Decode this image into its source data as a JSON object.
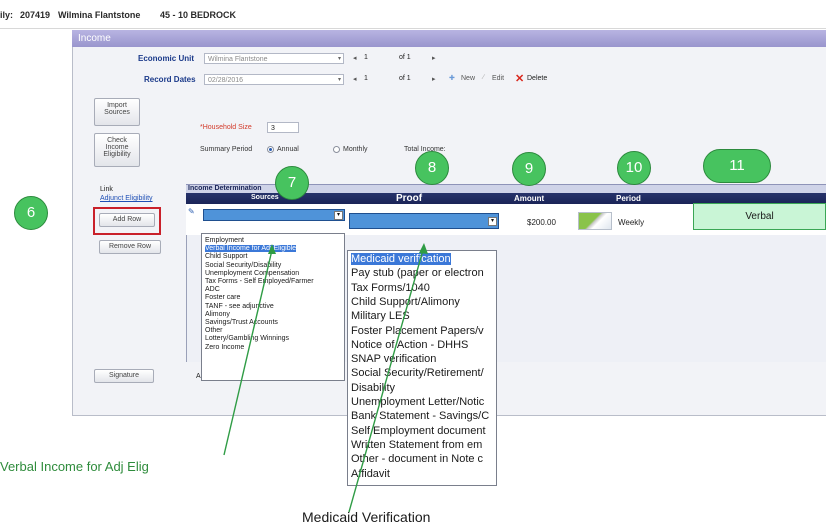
{
  "header": {
    "family_label": "ily:",
    "family_id": "207419",
    "family_name": "Wilmina Flantstone",
    "address": "45 - 10 BEDROCK"
  },
  "panel": {
    "title": "Income"
  },
  "economic_unit": {
    "label": "Economic Unit",
    "value": "Wilmina Flantstone",
    "page": "1",
    "of": "of 1"
  },
  "record_dates": {
    "label": "Record Dates",
    "value": "02/28/2016",
    "page": "1",
    "of": "of 1",
    "new_label": "New",
    "edit_label": "Edit",
    "delete_label": "Delete"
  },
  "side_buttons": {
    "import": "Import Sources",
    "check": "Check Income Eligibility",
    "link_label": "Link",
    "adjunct_link": "Adjunct Eligibility",
    "add_row": "Add Row",
    "remove_row": "Remove Row",
    "signature": "Signature"
  },
  "household": {
    "label": "*Household Size",
    "value": "3",
    "summary_label": "Summary Period",
    "annual": "Annual",
    "monthly": "Monthly",
    "total_label": "Total Income:"
  },
  "grid": {
    "section_title": "Income Determination",
    "columns": [
      "Sources",
      "Proof",
      "Amount",
      "Period"
    ],
    "row": {
      "amount": "$200.00",
      "period": "Weekly",
      "verbal": "Verbal"
    },
    "bottom_a": "A"
  },
  "sources_list": [
    "Employment",
    "Verbal Income for Adj Eligible",
    "Child Support",
    "Social Security/Disability",
    "Unemployment Compensation",
    "Tax Forms - Self Employed/Farmer",
    "ADC",
    "Foster care",
    "TANF - see adjunctive",
    "Alimony",
    "Savings/Trust Accounts",
    "Other",
    "Lottery/Gambling Winnings",
    "Zero Income"
  ],
  "sources_selected_index": 1,
  "proof_list": [
    "Medicaid verification",
    "Pay stub (paper or electron",
    "Tax Forms/1040",
    "Child Support/Alimony",
    "Military LES",
    "Foster Placement Papers/v",
    "Notice of Action - DHHS",
    "SNAP verification",
    "Social Security/Retirement/",
    "Disability",
    "Unemployment Letter/Notic",
    "Bank Statement - Savings/C",
    "Self Employment document",
    "Written Statement from em",
    "Other - document in Note c",
    "Affidavit"
  ],
  "proof_selected_index": 0,
  "annotations": {
    "c6": "6",
    "c7": "7",
    "c8": "8",
    "c9": "9",
    "c10": "10",
    "c11": "11",
    "verbal_note": "Verbal Income for Adj Elig",
    "medicaid_note": "Medicaid Verification"
  },
  "colors": {
    "title_bar": "#9995cd",
    "grid_header": "#1a2457",
    "highlight": "#3b78d8",
    "annotation_green": "#47c35f",
    "verbal_cell": "#c9f5d6",
    "delete_red": "#d9261c"
  }
}
